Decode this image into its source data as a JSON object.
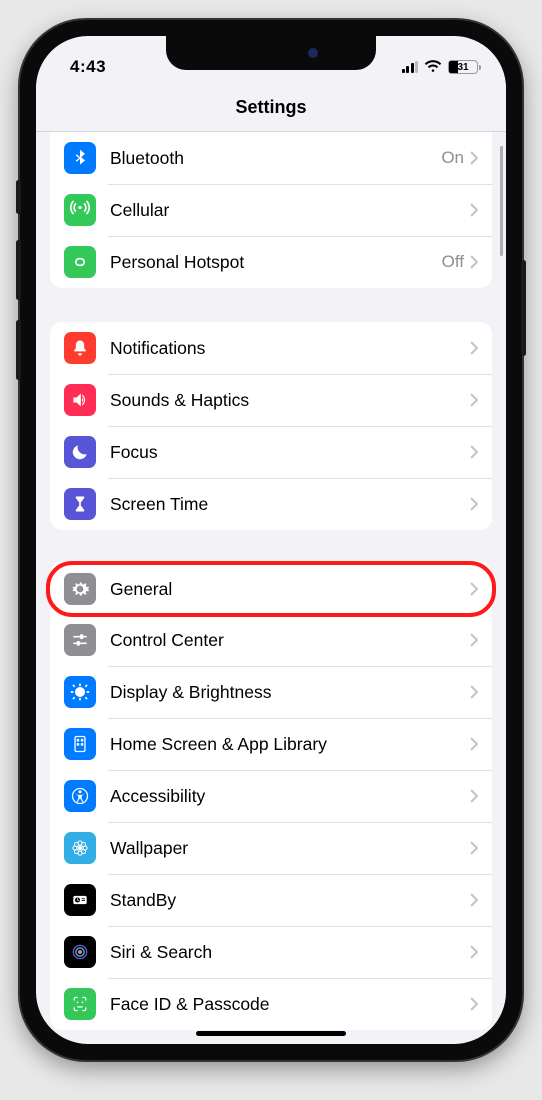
{
  "status": {
    "time": "4:43",
    "battery_pct": "31"
  },
  "header": {
    "title": "Settings"
  },
  "groups": [
    {
      "rows": [
        {
          "id": "bluetooth",
          "label": "Bluetooth",
          "value": "On",
          "icon": "bluetooth",
          "color": "c-blue"
        },
        {
          "id": "cellular",
          "label": "Cellular",
          "value": "",
          "icon": "antenna",
          "color": "c-green"
        },
        {
          "id": "hotspot",
          "label": "Personal Hotspot",
          "value": "Off",
          "icon": "link",
          "color": "c-green"
        }
      ]
    },
    {
      "rows": [
        {
          "id": "notifications",
          "label": "Notifications",
          "value": "",
          "icon": "bell",
          "color": "c-red"
        },
        {
          "id": "sounds",
          "label": "Sounds & Haptics",
          "value": "",
          "icon": "speaker",
          "color": "c-pink"
        },
        {
          "id": "focus",
          "label": "Focus",
          "value": "",
          "icon": "moon",
          "color": "c-indigo"
        },
        {
          "id": "screentime",
          "label": "Screen Time",
          "value": "",
          "icon": "hourglass",
          "color": "c-indigo"
        }
      ]
    },
    {
      "rows": [
        {
          "id": "general",
          "label": "General",
          "value": "",
          "icon": "gear",
          "color": "c-gray",
          "highlight": true
        },
        {
          "id": "controlcenter",
          "label": "Control Center",
          "value": "",
          "icon": "sliders",
          "color": "c-gray"
        },
        {
          "id": "display",
          "label": "Display & Brightness",
          "value": "",
          "icon": "sun",
          "color": "c-blue"
        },
        {
          "id": "homescreen",
          "label": "Home Screen & App Library",
          "value": "",
          "icon": "grid",
          "color": "c-blue"
        },
        {
          "id": "accessibility",
          "label": "Accessibility",
          "value": "",
          "icon": "person",
          "color": "c-blue"
        },
        {
          "id": "wallpaper",
          "label": "Wallpaper",
          "value": "",
          "icon": "flower",
          "color": "c-cyan"
        },
        {
          "id": "standby",
          "label": "StandBy",
          "value": "",
          "icon": "clock",
          "color": "c-black"
        },
        {
          "id": "siri",
          "label": "Siri & Search",
          "value": "",
          "icon": "siri",
          "color": "c-black"
        },
        {
          "id": "faceid",
          "label": "Face ID & Passcode",
          "value": "",
          "icon": "face",
          "color": "c-green"
        }
      ]
    }
  ],
  "annotation": {
    "highlighted_row": "general"
  }
}
